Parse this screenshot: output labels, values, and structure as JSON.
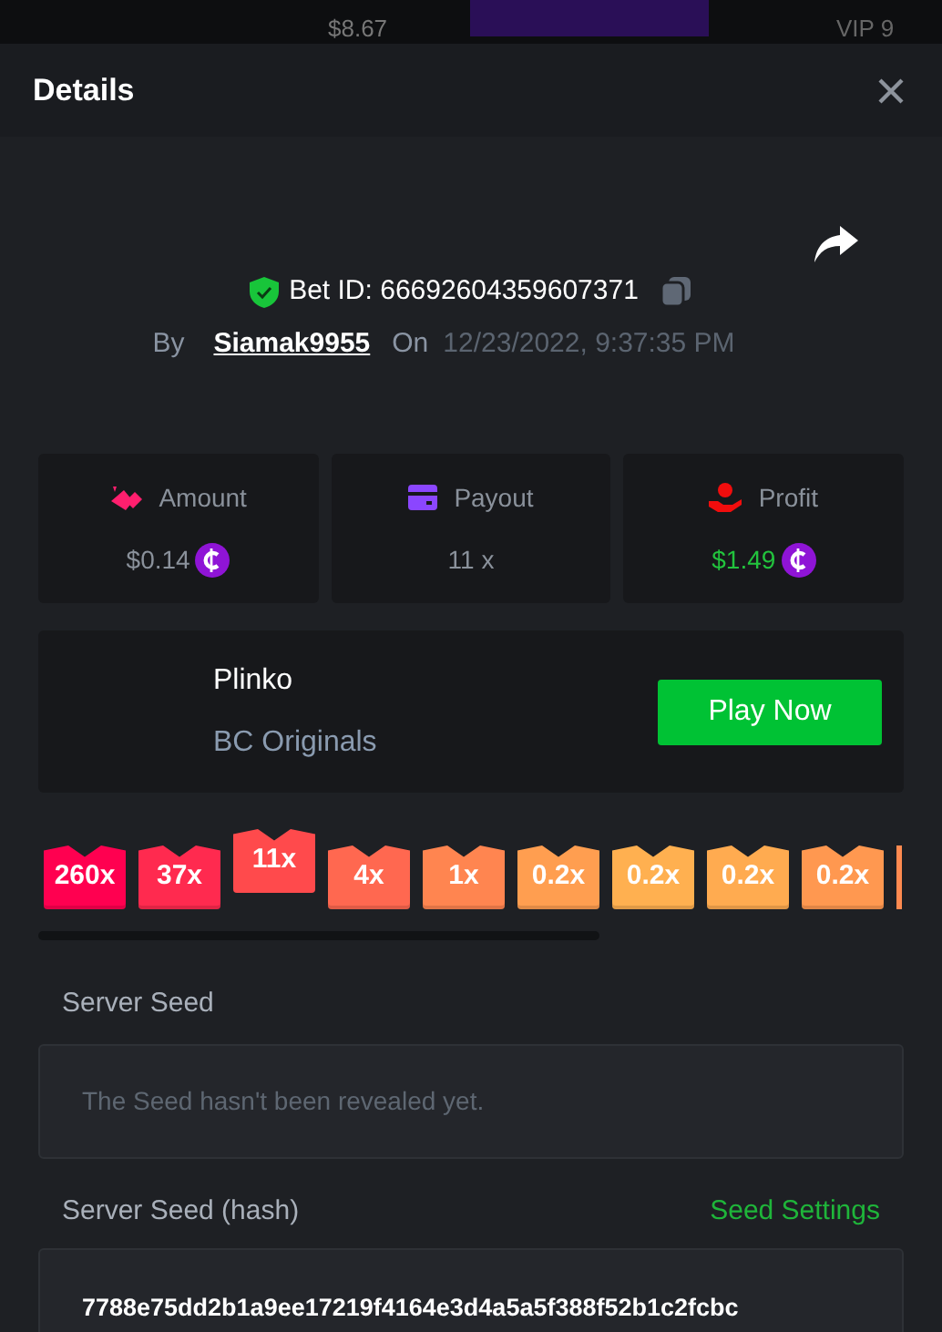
{
  "background": {
    "balance": "$8.67",
    "vip": "VIP 9"
  },
  "dialog": {
    "title": "Details"
  },
  "bet": {
    "id_label": "Bet ID: 66692604359607371",
    "verified": true,
    "by_label": "By",
    "user": "Siamak9955",
    "on_label": "On",
    "date": "12/23/2022, 9:37:35 PM"
  },
  "stats": [
    {
      "kind": "amount",
      "label": "Amount",
      "value": "$0.14",
      "coin": true,
      "color": "#ff1f6e"
    },
    {
      "kind": "payout",
      "label": "Payout",
      "value": "11 x",
      "coin": false,
      "color": "#8b46ff"
    },
    {
      "kind": "profit",
      "label": "Profit",
      "value": "$1.49",
      "coin": true,
      "color": "#f10d0d"
    }
  ],
  "game": {
    "name": "Plinko",
    "provider": "BC Originals",
    "button": "Play Now"
  },
  "buckets": [
    {
      "label": "260x",
      "color": "#ff0050",
      "selected": false
    },
    {
      "label": "37x",
      "color": "#ff2a4f",
      "selected": false
    },
    {
      "label": "11x",
      "color": "#ff4a4c",
      "selected": true
    },
    {
      "label": "4x",
      "color": "#ff6850",
      "selected": false
    },
    {
      "label": "1x",
      "color": "#ff8550",
      "selected": false
    },
    {
      "label": "0.2x",
      "color": "#ff9e50",
      "selected": false
    },
    {
      "label": "0.2x",
      "color": "#ffb050",
      "selected": false
    },
    {
      "label": "0.2x",
      "color": "#ffab50",
      "selected": false
    },
    {
      "label": "0.2x",
      "color": "#ff9850",
      "selected": false
    }
  ],
  "partial_bucket": {
    "color": "#ff8a50"
  },
  "server_seed": {
    "label": "Server Seed",
    "placeholder": "The Seed hasn't been revealed yet."
  },
  "server_seed_hash": {
    "label": "Server Seed (hash)",
    "link": "Seed Settings",
    "value": "7788e75dd2b1a9ee17219f4164e3d4a5a5f388f52b1c2fcbc"
  }
}
